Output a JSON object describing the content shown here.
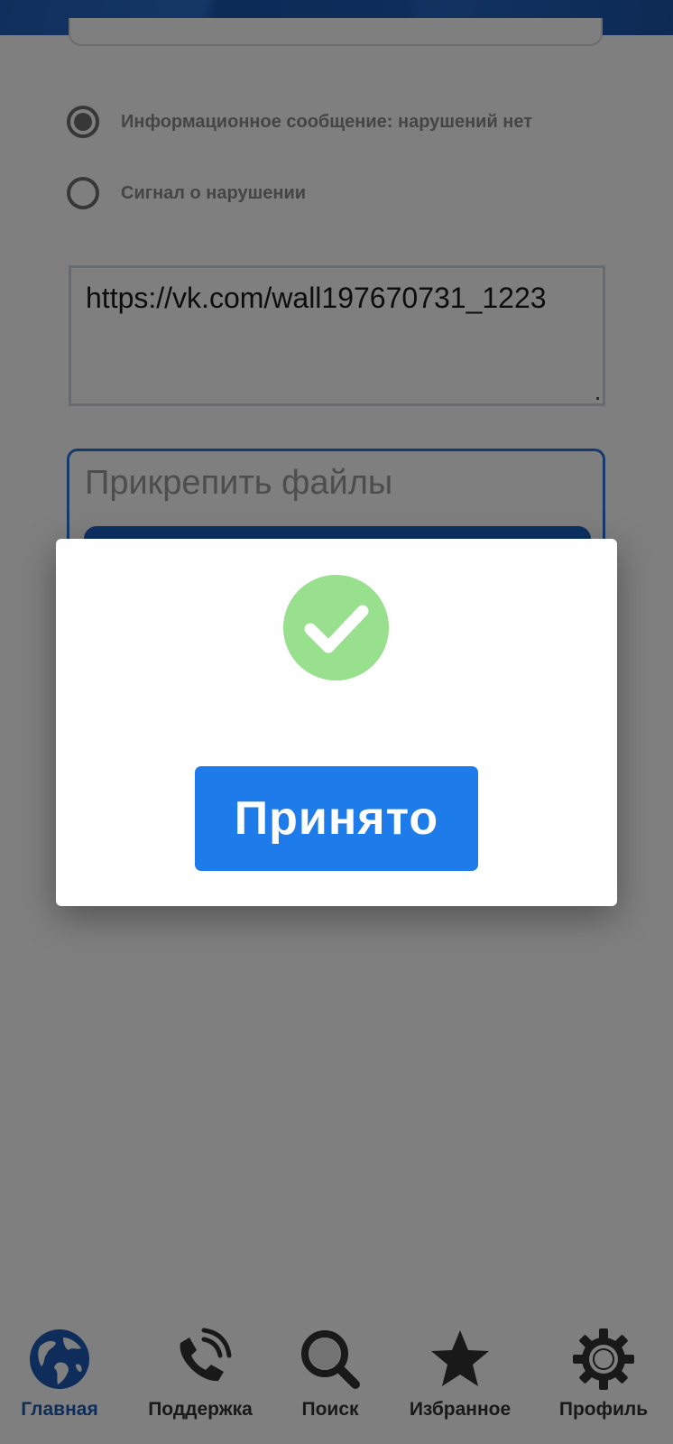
{
  "form": {
    "radio_options": [
      {
        "label": "Информационное сообщение: нарушений нет",
        "selected": true
      },
      {
        "label": "Сигнал о нарушении",
        "selected": false
      }
    ],
    "link_value": "https://vk.com/wall197670731_1223",
    "attach_label": "Прикрепить файлы"
  },
  "modal": {
    "icon": "check-circle-icon",
    "button_label": "Принято",
    "accent_color": "#1d7bea",
    "success_color": "#98e08e"
  },
  "bottom_nav": {
    "items": [
      {
        "label": "Главная",
        "icon": "globe-icon",
        "active": true
      },
      {
        "label": "Поддержка",
        "icon": "phone-icon",
        "active": false
      },
      {
        "label": "Поиск",
        "icon": "search-icon",
        "active": false
      },
      {
        "label": "Избранное",
        "icon": "star-icon",
        "active": false
      },
      {
        "label": "Профиль",
        "icon": "gear-icon",
        "active": false
      }
    ]
  }
}
